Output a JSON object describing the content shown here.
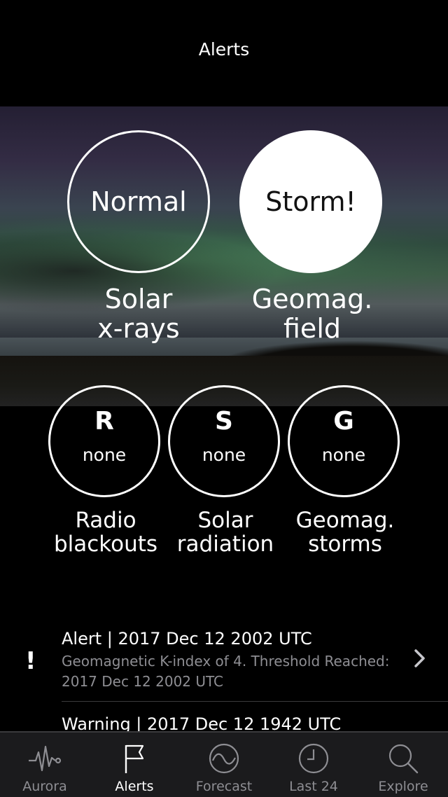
{
  "nav": {
    "title": "Alerts"
  },
  "hero": {
    "xray": {
      "status": "Normal",
      "label_line1": "Solar",
      "label_line2": "x-rays"
    },
    "geomag": {
      "status": "Storm!",
      "label_line1": "Geomag.",
      "label_line2": "field"
    }
  },
  "scales": [
    {
      "letter": "R",
      "value": "none",
      "label_line1": "Radio",
      "label_line2": "blackouts"
    },
    {
      "letter": "S",
      "value": "none",
      "label_line1": "Solar",
      "label_line2": "radiation"
    },
    {
      "letter": "G",
      "value": "none",
      "label_line1": "Geomag.",
      "label_line2": "storms"
    }
  ],
  "alerts": [
    {
      "icon": "!",
      "title": "Alert | 2017 Dec 12 2002 UTC",
      "description": "Geomagnetic K-index of 4. Threshold Reached: 2017 Dec 12 2002 UTC"
    },
    {
      "title": "Warning | 2017 Dec 12 1942 UTC"
    }
  ],
  "tabs": [
    {
      "label": "Aurora",
      "icon": "waveform-icon",
      "active": false
    },
    {
      "label": "Alerts",
      "icon": "flag-icon",
      "active": true
    },
    {
      "label": "Forecast",
      "icon": "wave-circle-icon",
      "active": false
    },
    {
      "label": "Last 24",
      "icon": "clock-icon",
      "active": false
    },
    {
      "label": "Explore",
      "icon": "magnifier-icon",
      "active": false
    }
  ],
  "colors": {
    "background": "#000000",
    "tab_bar": "#1b1b1d",
    "inactive_tab": "#8e8e93",
    "secondary_text": "#8e8e93"
  }
}
